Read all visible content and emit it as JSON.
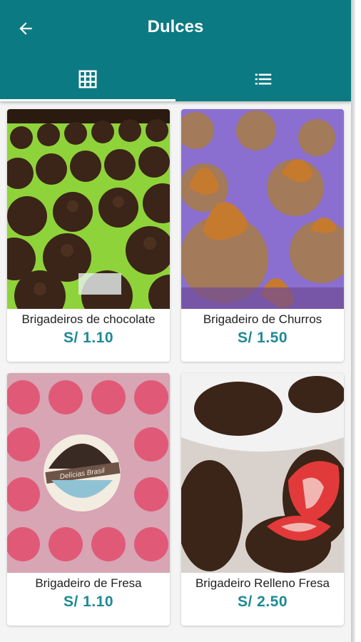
{
  "appbar": {
    "title": "Dulces",
    "back_icon": "arrow-left-icon",
    "background": "#0b7a83"
  },
  "tabs": [
    {
      "icon": "grid-view-icon",
      "active": true
    },
    {
      "icon": "list-view-icon",
      "active": false
    }
  ],
  "products": [
    {
      "name": "Brigadeiros de chocolate",
      "price": "S/  1.10"
    },
    {
      "name": "Brigadeiro de Churros",
      "price": "S/  1.50"
    },
    {
      "name": "Brigadeiro de Fresa",
      "price": "S/  1.10"
    },
    {
      "name": "Brigadeiro Relleno Fresa",
      "price": "S/  2.50"
    }
  ],
  "logo": {
    "text": "Delícias Brasil"
  },
  "colors": {
    "accent": "#0b7a83",
    "price": "#1d8a94"
  }
}
